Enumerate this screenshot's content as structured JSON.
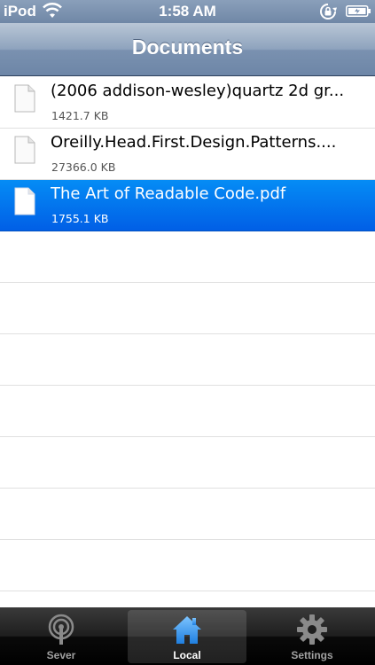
{
  "status": {
    "carrier": "iPod",
    "time": "1:58 AM"
  },
  "nav": {
    "title": "Documents"
  },
  "files": [
    {
      "name": "(2006 addison-wesley)quartz 2d gr...",
      "size": "1421.7 KB",
      "selected": false
    },
    {
      "name": "Oreilly.Head.First.Design.Patterns....",
      "size": "27366.0 KB",
      "selected": false
    },
    {
      "name": "The Art of Readable Code.pdf",
      "size": "1755.1 KB",
      "selected": true
    }
  ],
  "tabs": [
    {
      "label": "Sever",
      "icon": "antenna-icon",
      "active": false
    },
    {
      "label": "Local",
      "icon": "home-icon",
      "active": true
    },
    {
      "label": "Settings",
      "icon": "gear-icon",
      "active": false
    }
  ],
  "colors": {
    "selection": "#0a78f0",
    "nav_bar": "#7a91b0",
    "tab_active": "#3aa0f0"
  }
}
